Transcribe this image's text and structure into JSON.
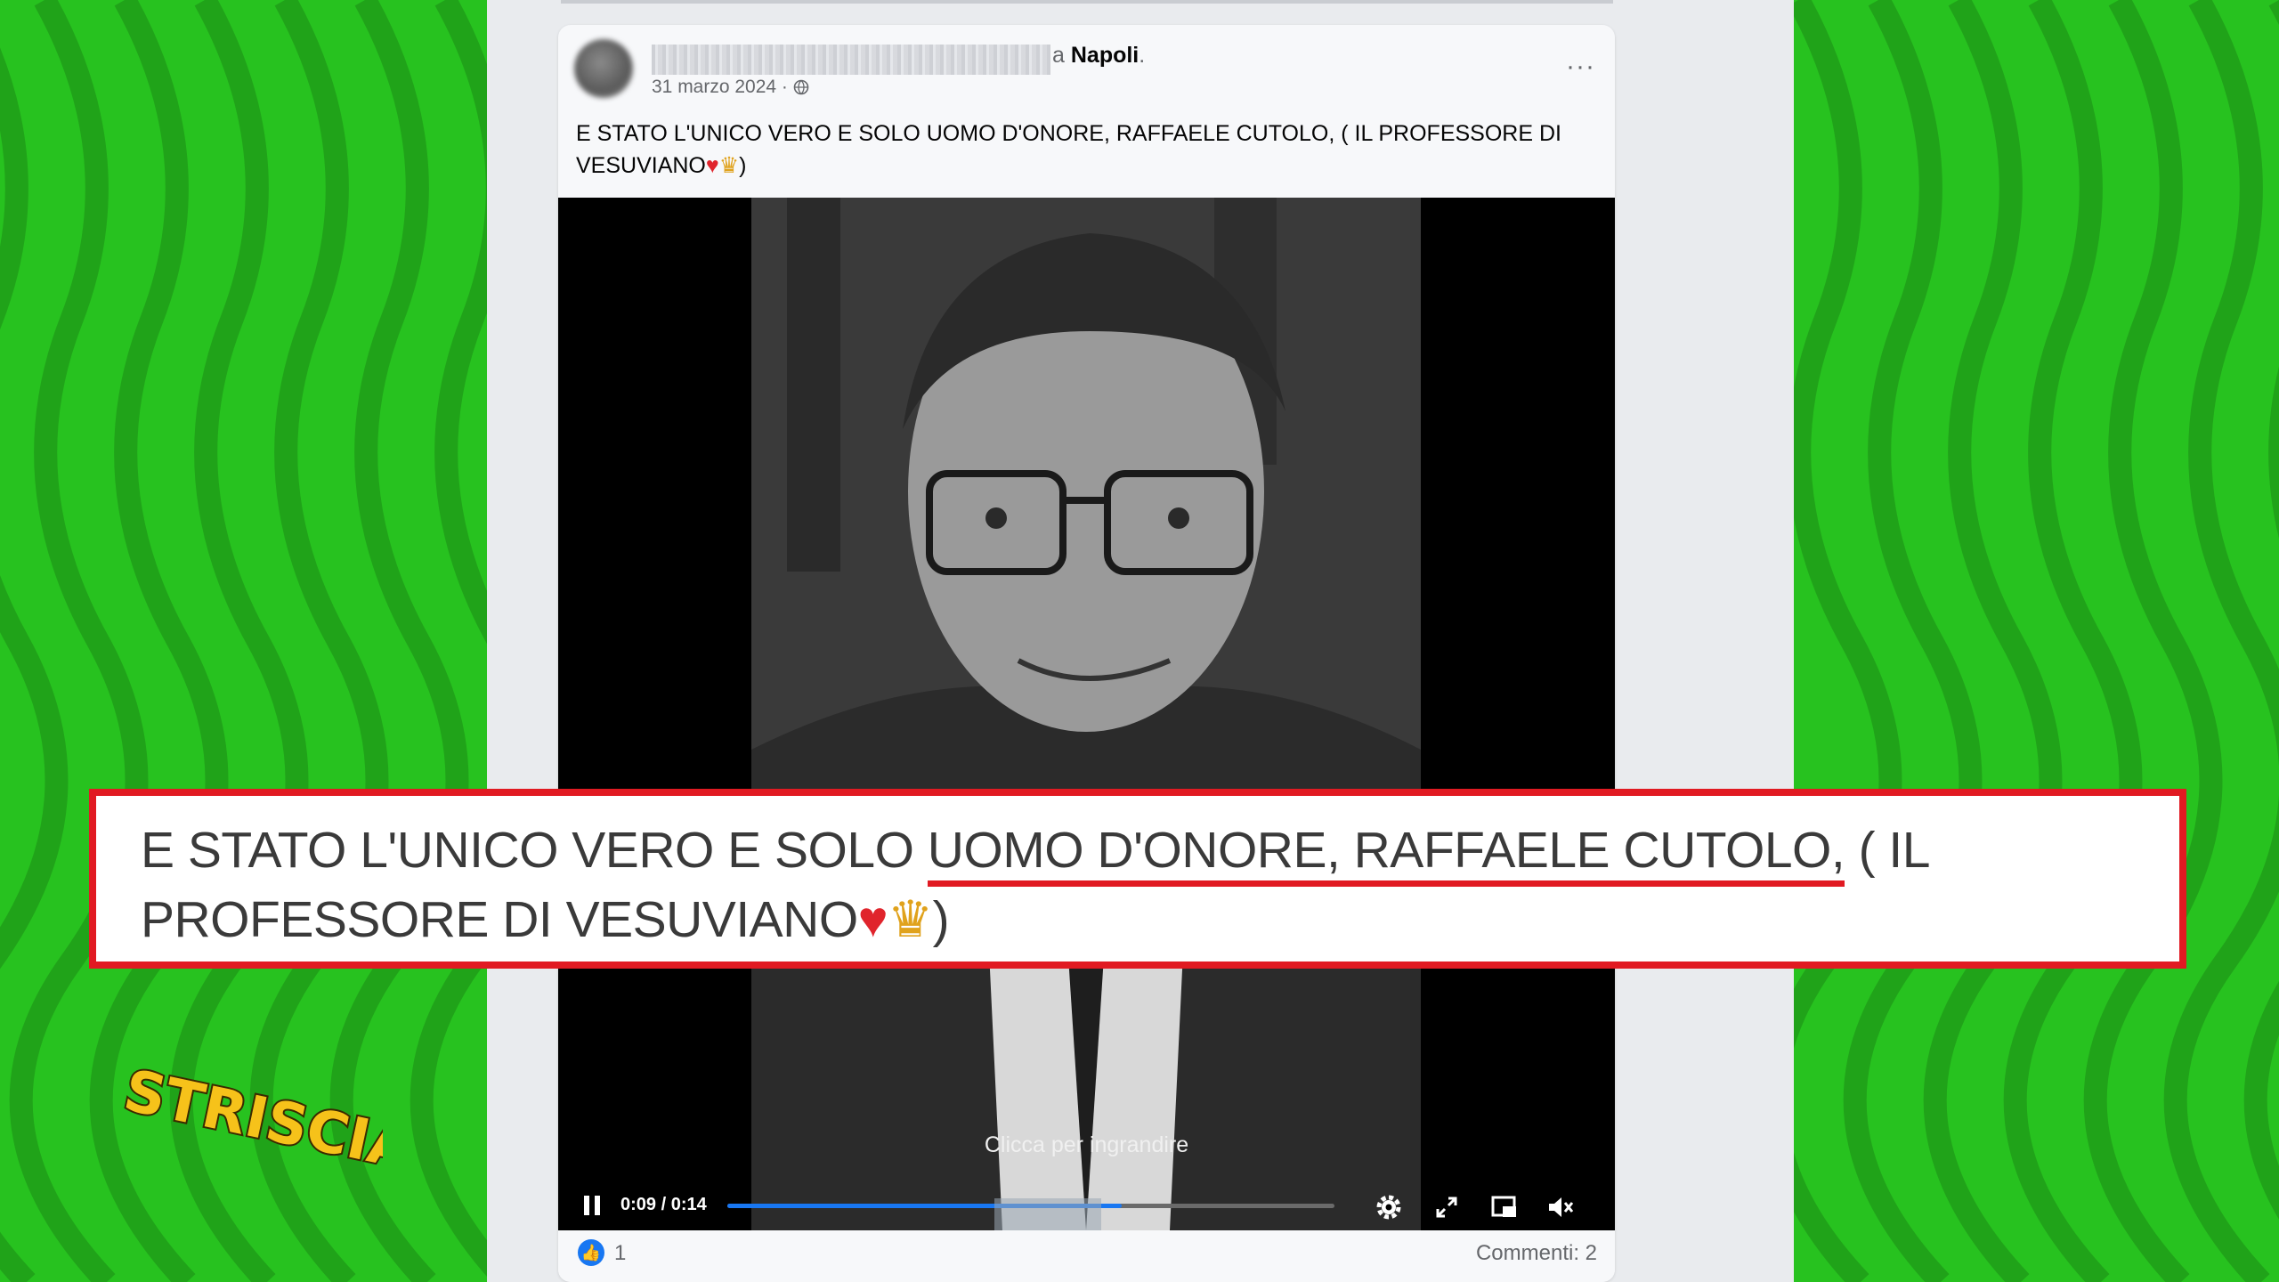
{
  "post": {
    "location_prefix": "a",
    "location": "Napoli",
    "location_suffix": ".",
    "date": "31 marzo 2024 ·",
    "more_label": "···",
    "text_main": "E STATO L'UNICO VERO E SOLO UOMO D'ONORE, RAFFAELE CUTOLO, ( IL PROFESSORE DI VESUVIANO",
    "text_heart": "♥",
    "text_crown": "♛",
    "text_end": ")"
  },
  "video": {
    "caption": "Clicca per ingrandire",
    "time": "0:09 / 0:14",
    "progress": 0.65
  },
  "footer": {
    "likes": "1",
    "comments": "Commenti: 2"
  },
  "overlay": {
    "part1": "E STATO L'UNICO VERO E SOLO ",
    "highlighted": "UOMO D'ONORE, RAFFAELE CUTOLO,",
    "part2": " ( IL PROFESSORE DI VESUVIANO",
    "heart": "♥",
    "crown": "♛",
    "end": ")"
  },
  "logo": {
    "text": "STRISCIA"
  },
  "colors": {
    "background_green": "#27c21f",
    "banner_red": "#e11a22",
    "facebook_blue": "#1877f2"
  }
}
